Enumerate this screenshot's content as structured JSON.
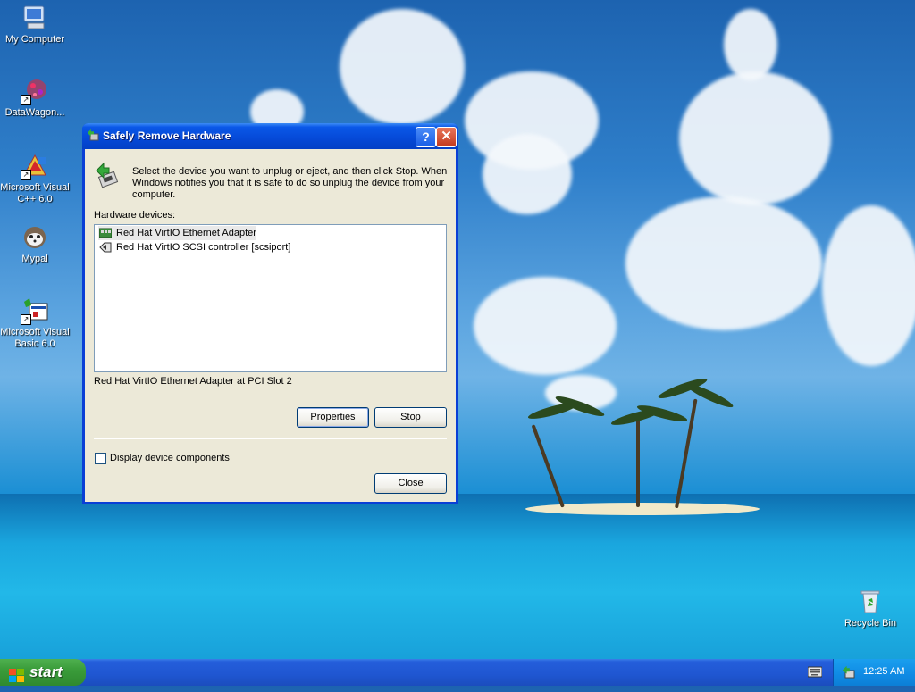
{
  "desktop": {
    "icons": [
      {
        "label": "My Computer",
        "icon": "my-computer-icon"
      },
      {
        "label": "DataWagon...",
        "icon": "datawagon-icon"
      },
      {
        "label": "Microsoft Visual C++ 6.0",
        "icon": "visual-cpp-icon"
      },
      {
        "label": "Mypal",
        "icon": "mypal-icon"
      },
      {
        "label": "Microsoft Visual Basic 6.0",
        "icon": "visual-basic-icon"
      },
      {
        "label": "Recycle Bin",
        "icon": "recycle-bin-icon"
      }
    ]
  },
  "dialog": {
    "title": "Safely Remove Hardware",
    "help_button": "?",
    "close_button": "✕",
    "intro": "Select the device you want to unplug or eject, and then click Stop. When Windows notifies you that it is safe to do so unplug the device from your computer.",
    "hardware_label": "Hardware devices:",
    "devices": [
      {
        "label": "Red Hat VirtIO Ethernet Adapter",
        "icon": "network-adapter-icon",
        "selected": true
      },
      {
        "label": "Red Hat VirtIO SCSI controller [scsiport]",
        "icon": "scsi-controller-icon",
        "selected": false
      }
    ],
    "status": "Red Hat VirtIO Ethernet Adapter at PCI Slot 2",
    "properties_button": "Properties",
    "stop_button": "Stop",
    "checkbox_label": "Display device components",
    "checkbox_checked": false,
    "close_label": "Close"
  },
  "taskbar": {
    "start_label": "start",
    "clock": "12:25 AM"
  }
}
